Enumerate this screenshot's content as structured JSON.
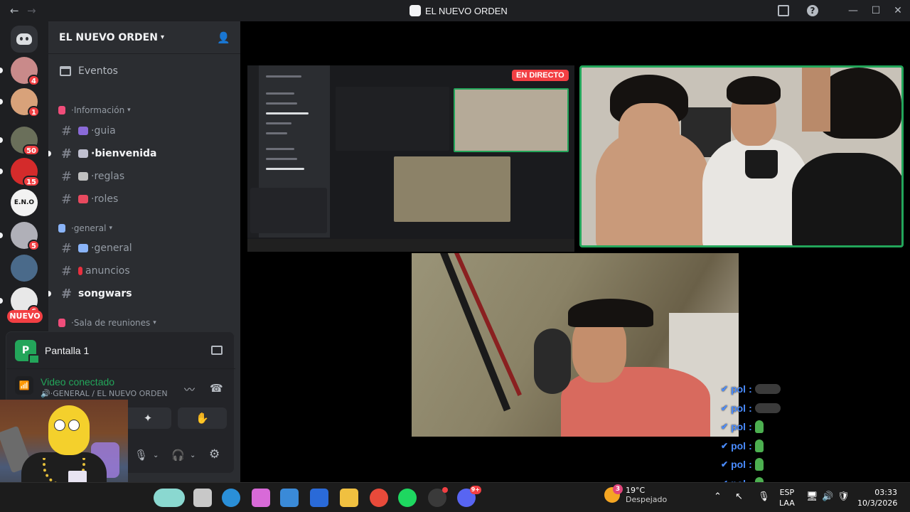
{
  "window": {
    "title": "EL NUEVO ORDEN",
    "back": "←",
    "forward": "→",
    "minimize": "—",
    "maximize": "☐",
    "close": "✕",
    "help": "?"
  },
  "server_rail": {
    "servers": [
      {
        "name": "server-1",
        "badge": "4",
        "color": "#c98a8a"
      },
      {
        "name": "server-2",
        "badge": "1",
        "color": "#d8a27a"
      },
      {
        "name": "server-3",
        "badge": "50",
        "color": "#6a6f5a"
      },
      {
        "name": "server-4",
        "badge": "15",
        "color": "#d42b2b"
      },
      {
        "name": "server-5",
        "badge": "",
        "label": "E.N.O",
        "color": "#f2f2f2"
      },
      {
        "name": "server-6",
        "badge": "5",
        "color": "#b0b0b8"
      },
      {
        "name": "server-7",
        "badge": "",
        "color": "#4a6a8a"
      },
      {
        "name": "server-8",
        "badge": "6",
        "color": "#e8e8e8"
      }
    ],
    "nuevo_label": "NUEVO"
  },
  "sidebar": {
    "server_name": "EL NUEVO ORDEN",
    "events": "Eventos",
    "categories": [
      {
        "label": "·Información",
        "emoji_color": "#f04d7a"
      },
      {
        "label": "·general",
        "emoji_color": "#8ab4f8"
      },
      {
        "label": "·Sala de reuniones",
        "emoji_color": "#f04d7a"
      }
    ],
    "channels": [
      {
        "name": "·guia",
        "emoji_color": "#8a6ad8",
        "bold": false
      },
      {
        "name": "·bienvenida",
        "emoji_color": "#c0c0d0",
        "bold": true
      },
      {
        "name": "·reglas",
        "emoji_color": "#c0c0c0",
        "bold": false
      },
      {
        "name": "·roles",
        "emoji_color": "#e84a5f",
        "bold": false
      },
      {
        "name": "·general",
        "emoji_color": "#8ab4f8",
        "bold": false
      },
      {
        "name": "anuncios",
        "emoji_color": "#e8303f",
        "bold": false
      },
      {
        "name": "songwars",
        "emoji_color": "",
        "bold": true
      }
    ]
  },
  "voice_panel": {
    "screen_label": "Pantalla 1",
    "avatar_letter": "P",
    "status_title": "Video conectado",
    "status_sub": "🔊·GENERAL / EL NUEVO ORDEN"
  },
  "stage": {
    "live_label": "EN DIRECTO"
  },
  "chat_overlay": {
    "lines": [
      {
        "user": "pol",
        "emote": "dark"
      },
      {
        "user": "pol",
        "emote": "dark"
      },
      {
        "user": "pol",
        "emote": "green"
      },
      {
        "user": "pol",
        "emote": "green"
      },
      {
        "user": "pol",
        "emote": "green"
      },
      {
        "user": "pol",
        "emote": "green"
      },
      {
        "user": "pol",
        "emote": "green"
      }
    ],
    "separator": ":"
  },
  "taskbar": {
    "weather_temp": "19°C",
    "weather_desc": "Despejado",
    "weather_badge": "3",
    "lang_1": "ESP",
    "lang_2": "LAA",
    "time": "03:33",
    "date": "10/3/2026",
    "discord_badge": "9+",
    "apps": [
      {
        "name": "widgets",
        "color": "#8ad8d0"
      },
      {
        "name": "file-explorer-blank",
        "color": "#c8c8c8"
      },
      {
        "name": "edge",
        "color": "#2a8fd8"
      },
      {
        "name": "copilot",
        "color": "#d86ad8"
      },
      {
        "name": "store",
        "color": "#3a8ad8"
      },
      {
        "name": "outlook",
        "color": "#2a6ad8"
      },
      {
        "name": "file-explorer",
        "color": "#f0c040"
      },
      {
        "name": "chrome",
        "color": "#e84a3a"
      },
      {
        "name": "spotify",
        "color": "#1ed760"
      },
      {
        "name": "obs",
        "color": "#3a3a3a"
      },
      {
        "name": "discord",
        "color": "#5865f2"
      }
    ]
  }
}
